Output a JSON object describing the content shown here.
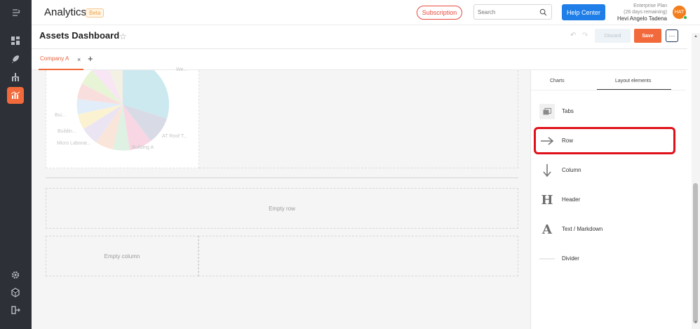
{
  "app": {
    "title": "Analytics",
    "badge": "Beta"
  },
  "topbar": {
    "subscription_label": "Subscription",
    "search_placeholder": "Search",
    "help_label": "Help Center",
    "plan_line1": "Enterprise Plan",
    "plan_line2": "(26 days remaining)",
    "user_name": "Hevi Angelo Tadena",
    "avatar_initials": "HAT"
  },
  "dashboard": {
    "title": "Assets Dashboard",
    "discard_label": "Discard",
    "save_label": "Save",
    "more_label": "···"
  },
  "tabs": [
    {
      "label": "Company A",
      "close": "×"
    }
  ],
  "add_tab": "+",
  "canvas": {
    "chart_labels": [
      "Bui...",
      "Buildin...",
      "Micro Laborat...",
      "Building A",
      "AT Roof T...",
      "We..."
    ],
    "empty_row_label": "Empty row",
    "empty_column_label": "Empty column"
  },
  "panel": {
    "tabs": [
      "Charts",
      "Layout elements"
    ],
    "active_tab": "Layout elements",
    "elements": [
      {
        "label": "Tabs",
        "icon": "tabs-icon"
      },
      {
        "label": "Row",
        "icon": "arrow-right-icon"
      },
      {
        "label": "Column",
        "icon": "arrow-down-icon"
      },
      {
        "label": "Header",
        "icon": "header-icon"
      },
      {
        "label": "Text / Markdown",
        "icon": "text-icon"
      },
      {
        "label": "Divider",
        "icon": "divider-icon"
      }
    ]
  },
  "colors": {
    "accent": "#f26a3b",
    "primary": "#1f7ee7",
    "highlight": "#e0101a",
    "rail": "#2d3036"
  }
}
